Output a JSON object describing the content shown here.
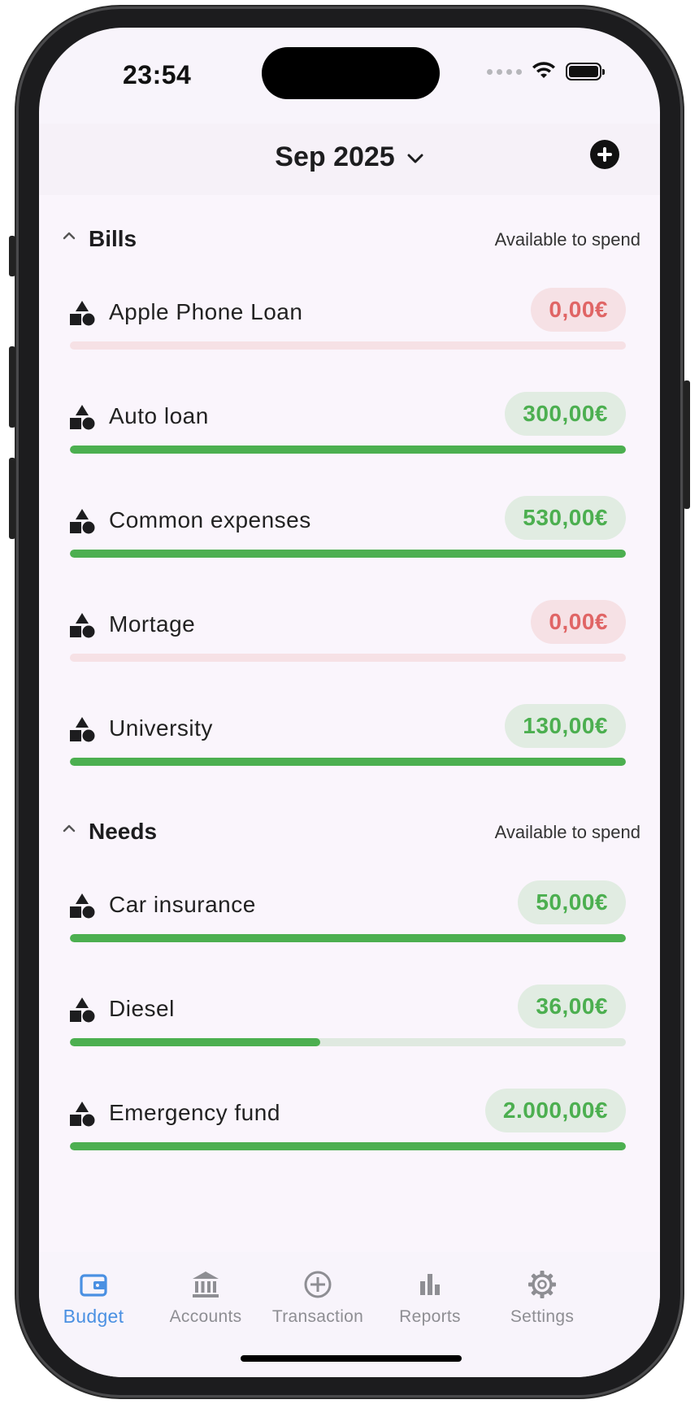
{
  "status_bar": {
    "time": "23:54"
  },
  "header": {
    "month": "Sep 2025"
  },
  "colors": {
    "accent": "#4a90e2",
    "positive": "#4caf50",
    "zero": "#e06565"
  },
  "sections": [
    {
      "title": "Bills",
      "right_label": "Available to spend",
      "items": [
        {
          "name": "Apple Phone Loan",
          "amount": "0,00€",
          "status": "zero",
          "progress": 0
        },
        {
          "name": "Auto loan",
          "amount": "300,00€",
          "status": "pos",
          "progress": 1
        },
        {
          "name": "Common expenses",
          "amount": "530,00€",
          "status": "pos",
          "progress": 1
        },
        {
          "name": "Mortage",
          "amount": "0,00€",
          "status": "zero",
          "progress": 0
        },
        {
          "name": "University",
          "amount": "130,00€",
          "status": "pos",
          "progress": 1
        }
      ]
    },
    {
      "title": "Needs",
      "right_label": "Available to spend",
      "items": [
        {
          "name": "Car insurance",
          "amount": "50,00€",
          "status": "pos",
          "progress": 1
        },
        {
          "name": "Diesel",
          "amount": "36,00€",
          "status": "pos",
          "progress": 0.45
        },
        {
          "name": "Emergency fund",
          "amount": "2.000,00€",
          "status": "pos",
          "progress": 1
        }
      ]
    }
  ],
  "tabs": [
    {
      "label": "Budget",
      "icon": "wallet-icon",
      "active": true
    },
    {
      "label": "Accounts",
      "icon": "bank-icon",
      "active": false
    },
    {
      "label": "Transaction",
      "icon": "add-circle-icon",
      "active": false
    },
    {
      "label": "Reports",
      "icon": "bar-chart-icon",
      "active": false
    },
    {
      "label": "Settings",
      "icon": "gear-icon",
      "active": false
    }
  ]
}
